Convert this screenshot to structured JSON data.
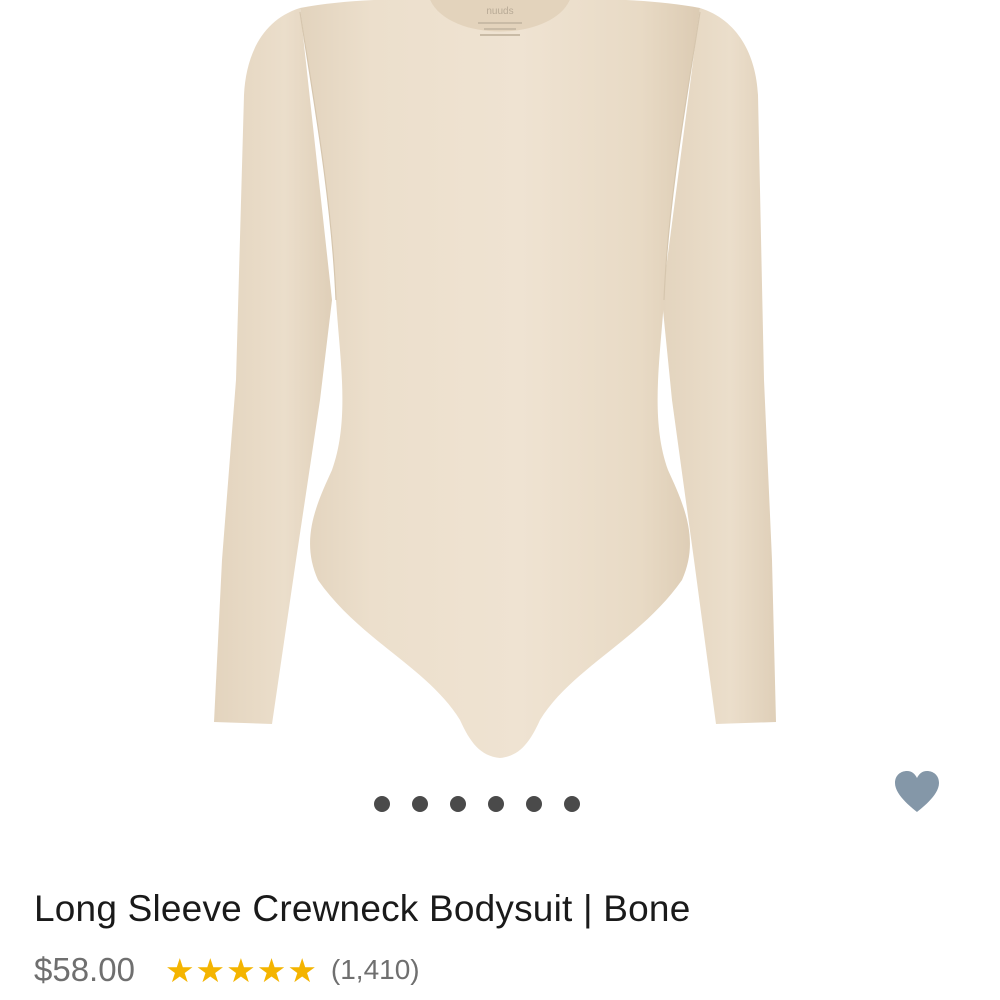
{
  "product": {
    "title": "Long Sleeve Crewneck Bodysuit | Bone",
    "price": "$58.00",
    "rating": 5,
    "review_count": "(1,410)",
    "image_icon": "bodysuit-product-photo",
    "garment_color": "#ecdfcc",
    "label_text": "nuuds"
  },
  "carousel": {
    "dot_count": 6,
    "dot_color": "#4a4a4a"
  },
  "favorite": {
    "icon": "heart-icon",
    "color": "#8497a8"
  },
  "colors": {
    "star": "#f4b400",
    "text": "#1a1a1a",
    "muted": "#6f6f6f"
  }
}
